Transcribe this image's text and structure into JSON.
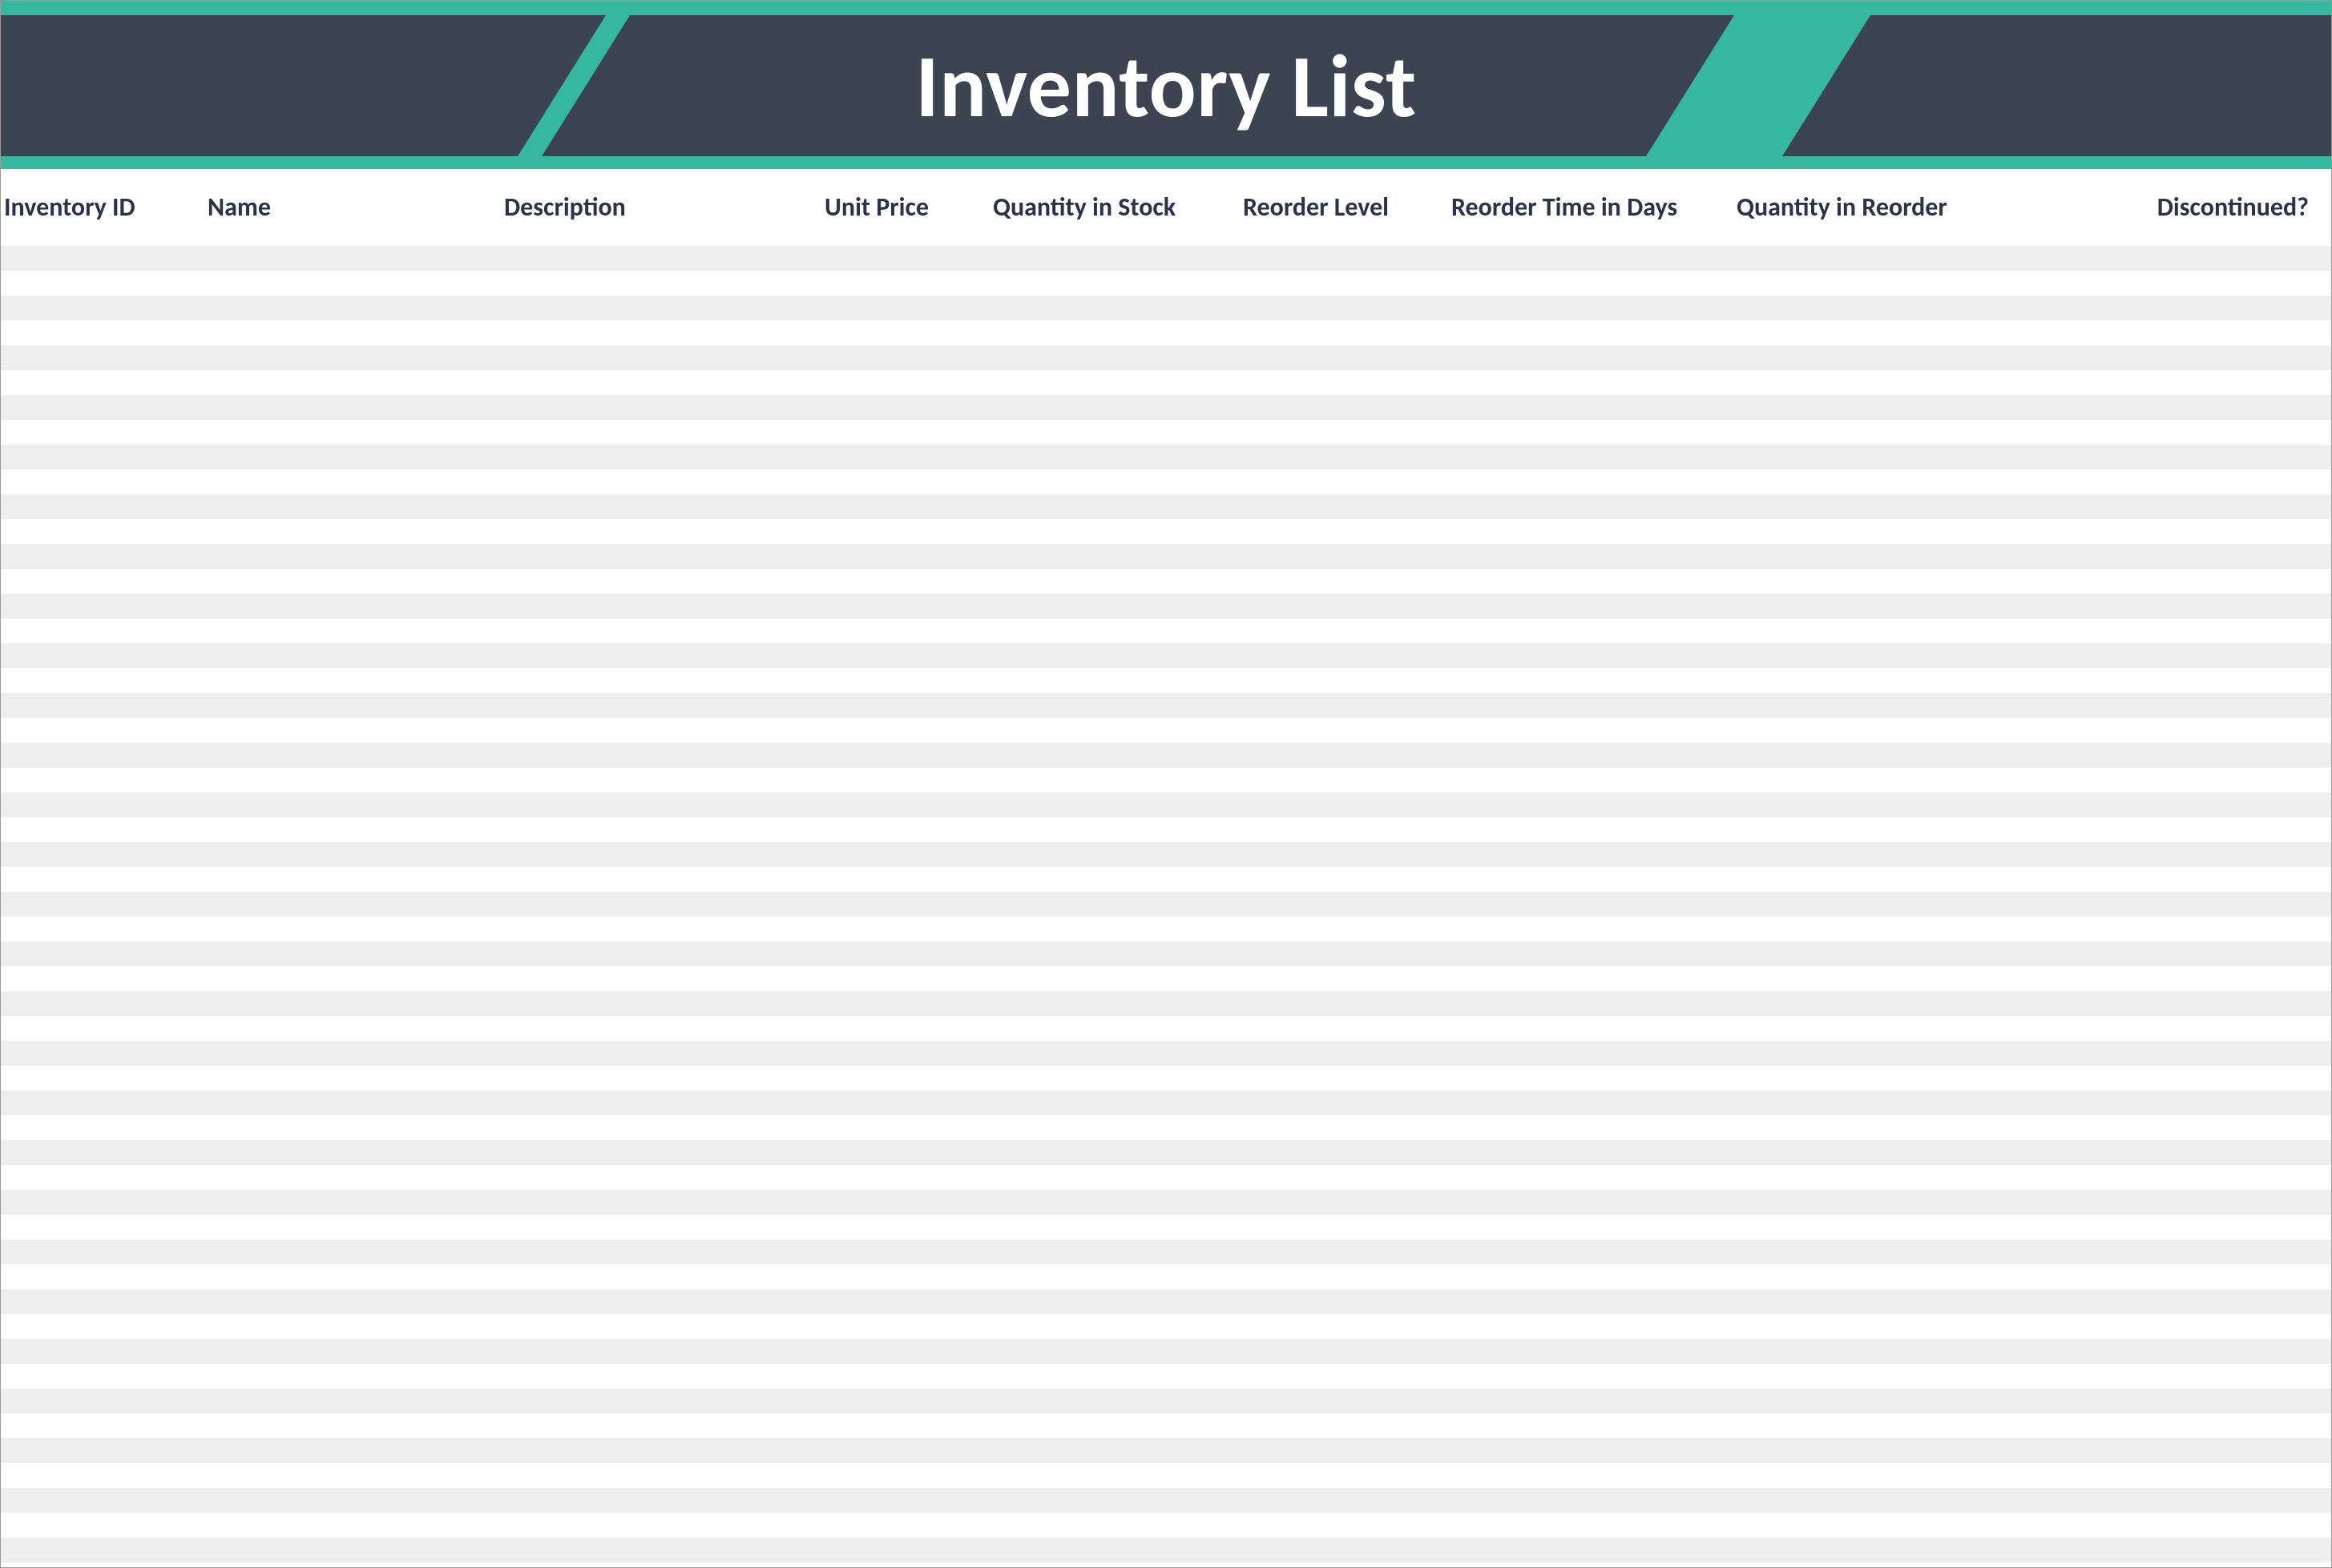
{
  "page_title": "Inventory List",
  "columns": [
    "Inventory ID",
    "Name",
    "Description",
    "Unit Price",
    "Quantity in Stock",
    "Reorder Level",
    "Reorder Time in Days",
    "Quantity in Reorder",
    "Discontinued?"
  ],
  "rows": [
    [
      "",
      "",
      "",
      "",
      "",
      "",
      "",
      "",
      ""
    ],
    [
      "",
      "",
      "",
      "",
      "",
      "",
      "",
      "",
      ""
    ],
    [
      "",
      "",
      "",
      "",
      "",
      "",
      "",
      "",
      ""
    ],
    [
      "",
      "",
      "",
      "",
      "",
      "",
      "",
      "",
      ""
    ],
    [
      "",
      "",
      "",
      "",
      "",
      "",
      "",
      "",
      ""
    ],
    [
      "",
      "",
      "",
      "",
      "",
      "",
      "",
      "",
      ""
    ],
    [
      "",
      "",
      "",
      "",
      "",
      "",
      "",
      "",
      ""
    ],
    [
      "",
      "",
      "",
      "",
      "",
      "",
      "",
      "",
      ""
    ],
    [
      "",
      "",
      "",
      "",
      "",
      "",
      "",
      "",
      ""
    ],
    [
      "",
      "",
      "",
      "",
      "",
      "",
      "",
      "",
      ""
    ],
    [
      "",
      "",
      "",
      "",
      "",
      "",
      "",
      "",
      ""
    ],
    [
      "",
      "",
      "",
      "",
      "",
      "",
      "",
      "",
      ""
    ],
    [
      "",
      "",
      "",
      "",
      "",
      "",
      "",
      "",
      ""
    ],
    [
      "",
      "",
      "",
      "",
      "",
      "",
      "",
      "",
      ""
    ],
    [
      "",
      "",
      "",
      "",
      "",
      "",
      "",
      "",
      ""
    ],
    [
      "",
      "",
      "",
      "",
      "",
      "",
      "",
      "",
      ""
    ],
    [
      "",
      "",
      "",
      "",
      "",
      "",
      "",
      "",
      ""
    ],
    [
      "",
      "",
      "",
      "",
      "",
      "",
      "",
      "",
      ""
    ],
    [
      "",
      "",
      "",
      "",
      "",
      "",
      "",
      "",
      ""
    ],
    [
      "",
      "",
      "",
      "",
      "",
      "",
      "",
      "",
      ""
    ],
    [
      "",
      "",
      "",
      "",
      "",
      "",
      "",
      "",
      ""
    ],
    [
      "",
      "",
      "",
      "",
      "",
      "",
      "",
      "",
      ""
    ],
    [
      "",
      "",
      "",
      "",
      "",
      "",
      "",
      "",
      ""
    ],
    [
      "",
      "",
      "",
      "",
      "",
      "",
      "",
      "",
      ""
    ],
    [
      "",
      "",
      "",
      "",
      "",
      "",
      "",
      "",
      ""
    ],
    [
      "",
      "",
      "",
      "",
      "",
      "",
      "",
      "",
      ""
    ],
    [
      "",
      "",
      "",
      "",
      "",
      "",
      "",
      "",
      ""
    ],
    [
      "",
      "",
      "",
      "",
      "",
      "",
      "",
      "",
      ""
    ],
    [
      "",
      "",
      "",
      "",
      "",
      "",
      "",
      "",
      ""
    ],
    [
      "",
      "",
      "",
      "",
      "",
      "",
      "",
      "",
      ""
    ],
    [
      "",
      "",
      "",
      "",
      "",
      "",
      "",
      "",
      ""
    ],
    [
      "",
      "",
      "",
      "",
      "",
      "",
      "",
      "",
      ""
    ],
    [
      "",
      "",
      "",
      "",
      "",
      "",
      "",
      "",
      ""
    ],
    [
      "",
      "",
      "",
      "",
      "",
      "",
      "",
      "",
      ""
    ],
    [
      "",
      "",
      "",
      "",
      "",
      "",
      "",
      "",
      ""
    ],
    [
      "",
      "",
      "",
      "",
      "",
      "",
      "",
      "",
      ""
    ],
    [
      "",
      "",
      "",
      "",
      "",
      "",
      "",
      "",
      ""
    ],
    [
      "",
      "",
      "",
      "",
      "",
      "",
      "",
      "",
      ""
    ],
    [
      "",
      "",
      "",
      "",
      "",
      "",
      "",
      "",
      ""
    ],
    [
      "",
      "",
      "",
      "",
      "",
      "",
      "",
      "",
      ""
    ],
    [
      "",
      "",
      "",
      "",
      "",
      "",
      "",
      "",
      ""
    ],
    [
      "",
      "",
      "",
      "",
      "",
      "",
      "",
      "",
      ""
    ],
    [
      "",
      "",
      "",
      "",
      "",
      "",
      "",
      "",
      ""
    ],
    [
      "",
      "",
      "",
      "",
      "",
      "",
      "",
      "",
      ""
    ],
    [
      "",
      "",
      "",
      "",
      "",
      "",
      "",
      "",
      ""
    ],
    [
      "",
      "",
      "",
      "",
      "",
      "",
      "",
      "",
      ""
    ],
    [
      "",
      "",
      "",
      "",
      "",
      "",
      "",
      "",
      ""
    ],
    [
      "",
      "",
      "",
      "",
      "",
      "",
      "",
      "",
      ""
    ],
    [
      "",
      "",
      "",
      "",
      "",
      "",
      "",
      "",
      ""
    ],
    [
      "",
      "",
      "",
      "",
      "",
      "",
      "",
      "",
      ""
    ],
    [
      "",
      "",
      "",
      "",
      "",
      "",
      "",
      "",
      ""
    ],
    [
      "",
      "",
      "",
      "",
      "",
      "",
      "",
      "",
      ""
    ],
    [
      "",
      "",
      "",
      "",
      "",
      "",
      "",
      "",
      ""
    ]
  ],
  "colors": {
    "accent": "#36b8a0",
    "dark": "#3c4351",
    "header_text": "#2a334a",
    "stripe": "#eeeeee"
  }
}
